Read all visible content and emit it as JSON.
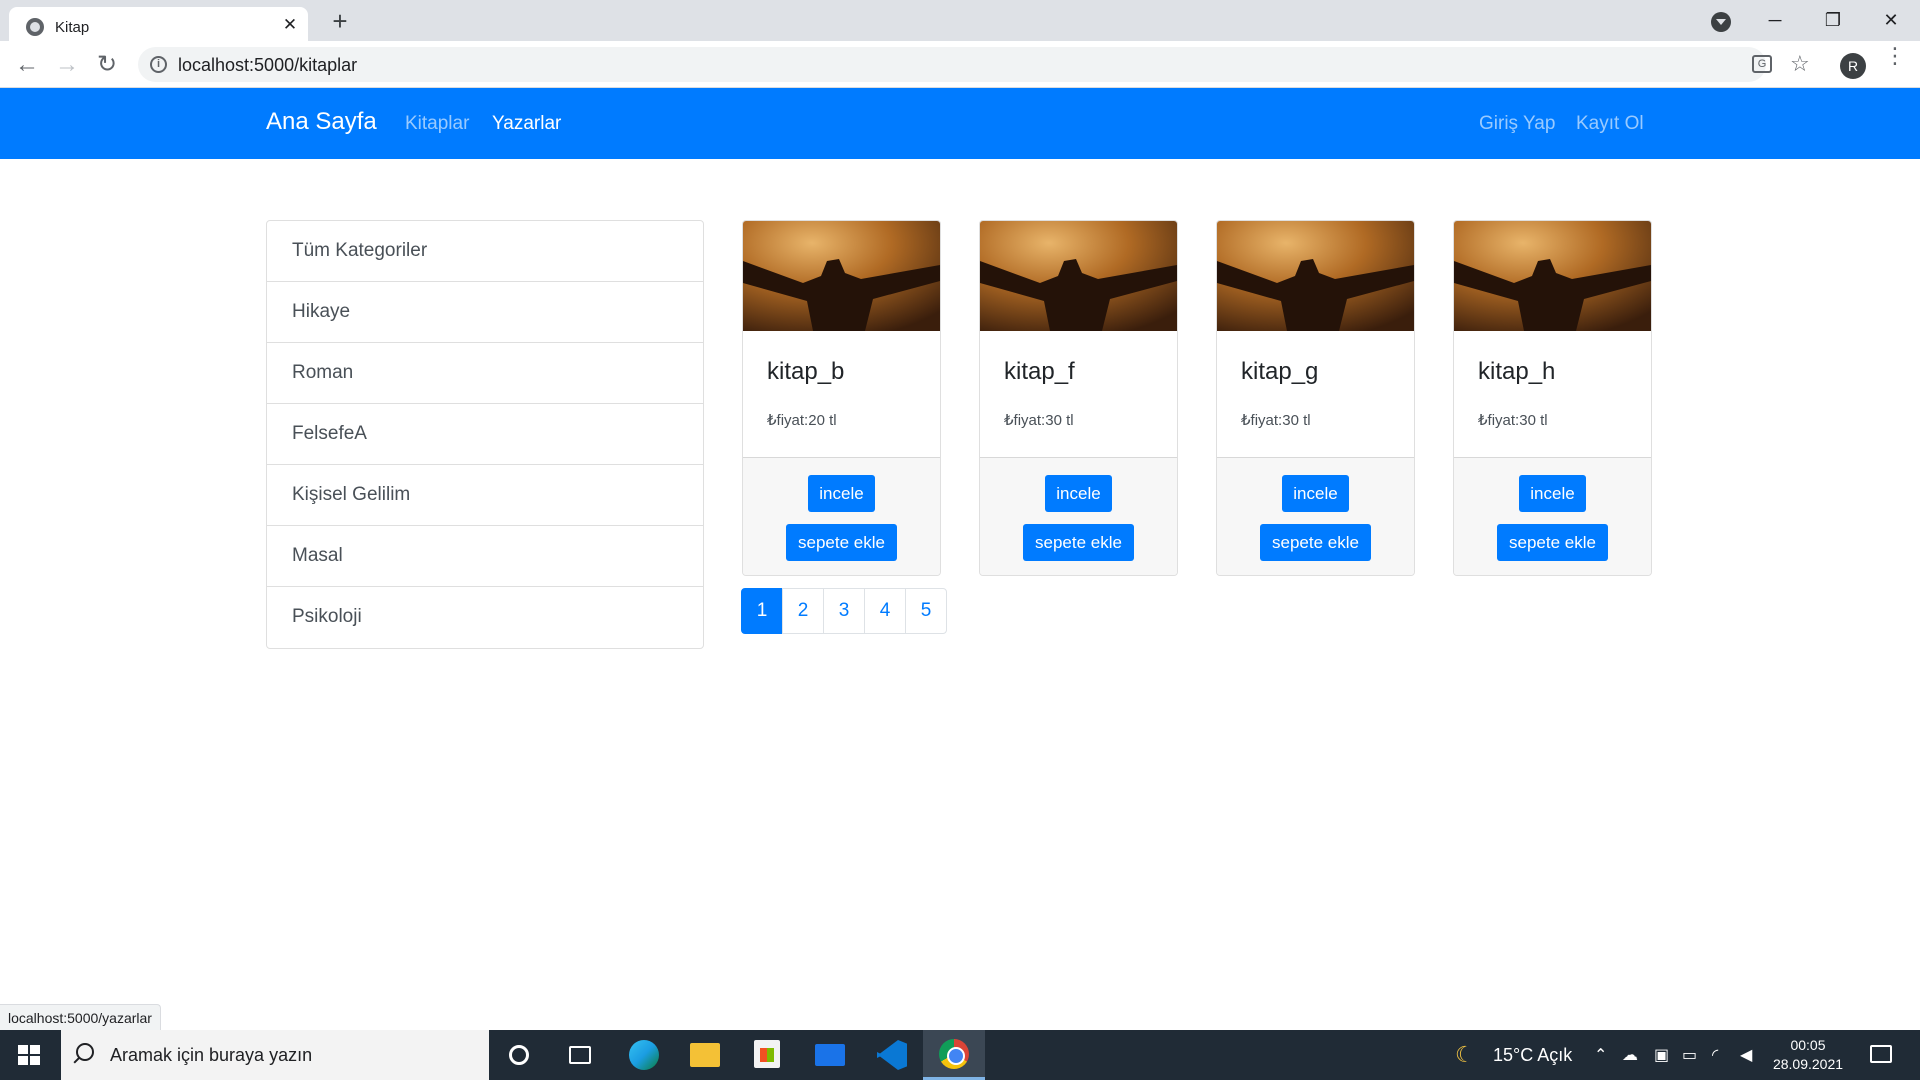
{
  "browser": {
    "tab_title": "Kitap",
    "tab_close": "✕",
    "new_tab": "+",
    "url": "localhost:5000/kitaplar",
    "avatar_letter": "R",
    "window_controls": {
      "minimize": "─",
      "maximize": "❐",
      "close": "✕"
    },
    "status_url": "localhost:5000/yazarlar"
  },
  "navbar": {
    "brand": "Ana Sayfa",
    "links": [
      "Kitaplar",
      "Yazarlar"
    ],
    "right_links": [
      "Giriş Yap",
      "Kayıt Ol"
    ],
    "color": "#007bff"
  },
  "categories": [
    "Tüm Kategoriler",
    "Hikaye",
    "Roman",
    "FelsefeA",
    "Kişisel Gelilim",
    "Masal",
    "Psikoloji"
  ],
  "books": [
    {
      "title": "kitap_b",
      "price": "₺fiyat:20 tl",
      "incele_label": "incele",
      "cart_label": "sepete ekle"
    },
    {
      "title": "kitap_f",
      "price": "₺fiyat:30 tl",
      "incele_label": "incele",
      "cart_label": "sepete ekle"
    },
    {
      "title": "kitap_g",
      "price": "₺fiyat:30 tl",
      "incele_label": "incele",
      "cart_label": "sepete ekle"
    },
    {
      "title": "kitap_h",
      "price": "₺fiyat:30 tl",
      "incele_label": "incele",
      "cart_label": "sepete ekle"
    }
  ],
  "pagination": {
    "pages": [
      "1",
      "2",
      "3",
      "4",
      "5"
    ],
    "active": "1"
  },
  "taskbar": {
    "search_placeholder": "Aramak için buraya yazın",
    "weather": "15°C  Açık",
    "time": "00:05",
    "date": "28.09.2021"
  }
}
